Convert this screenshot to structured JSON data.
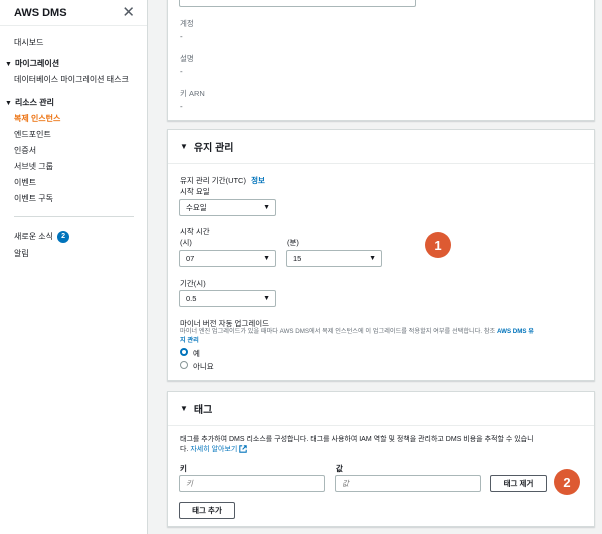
{
  "sidebar": {
    "title": "AWS DMS",
    "dashboard": "대시보드",
    "migration_section": "마이그레이션",
    "db_migration_tasks": "데이터베이스 마이그레이션 태스크",
    "resource_section": "리소스 관리",
    "replication_instances": "복제 인스턴스",
    "endpoints": "엔드포인트",
    "certificates": "인증서",
    "subnet_groups": "서브넷 그룹",
    "events": "이벤트",
    "event_subscriptions": "이벤트 구독",
    "whats_new": "새로운 소식",
    "whats_new_count": "2",
    "notifications": "알림"
  },
  "top_panel": {
    "account_label": "계정",
    "account_value": "-",
    "description_label": "설명",
    "description_value": "-",
    "key_arn_label": "키 ARN",
    "key_arn_value": "-"
  },
  "maintenance": {
    "title": "유지 관리",
    "window_label": "유지 관리 기간(UTC)",
    "info_link": "정보",
    "start_day_label": "시작 요일",
    "start_day_value": "수요일",
    "start_time_label": "시작 시간",
    "hour_label": "(시)",
    "hour_value": "07",
    "minute_label": "(분)",
    "minute_value": "15",
    "duration_label": "기간(시)",
    "duration_value": "0.5",
    "auto_upgrade_label": "마이너 버전 자동 업그레이드",
    "auto_upgrade_desc": "마이너 엔진 업그레이드가 있을 때마다 AWS DMS에서 복제 인스턴스에 이 업그레이드를 적용할지 여부를 선택합니다. 참조",
    "auto_upgrade_link_1": "AWS DMS 유",
    "auto_upgrade_link_2": "지 관리",
    "option_yes": "예",
    "option_no": "아니요"
  },
  "tags": {
    "title": "태그",
    "description": "태그를 추가하여 DMS 리소스를 구성합니다. 태그를 사용하여 IAM 역할 및 정책을 관리하고 DMS 비용을 추적할 수 있습니",
    "description_end": "다.",
    "learn_more": "자세히 알아보기",
    "key_label": "키",
    "value_label": "값",
    "key_placeholder": "키",
    "value_placeholder": "값",
    "remove_button": "태그 제거",
    "add_button": "태그 추가"
  },
  "markers": {
    "one": "1",
    "two": "2"
  },
  "colors": {
    "accent_orange": "#ec7211",
    "link_blue": "#0073bb",
    "marker": "#dd5a32"
  }
}
